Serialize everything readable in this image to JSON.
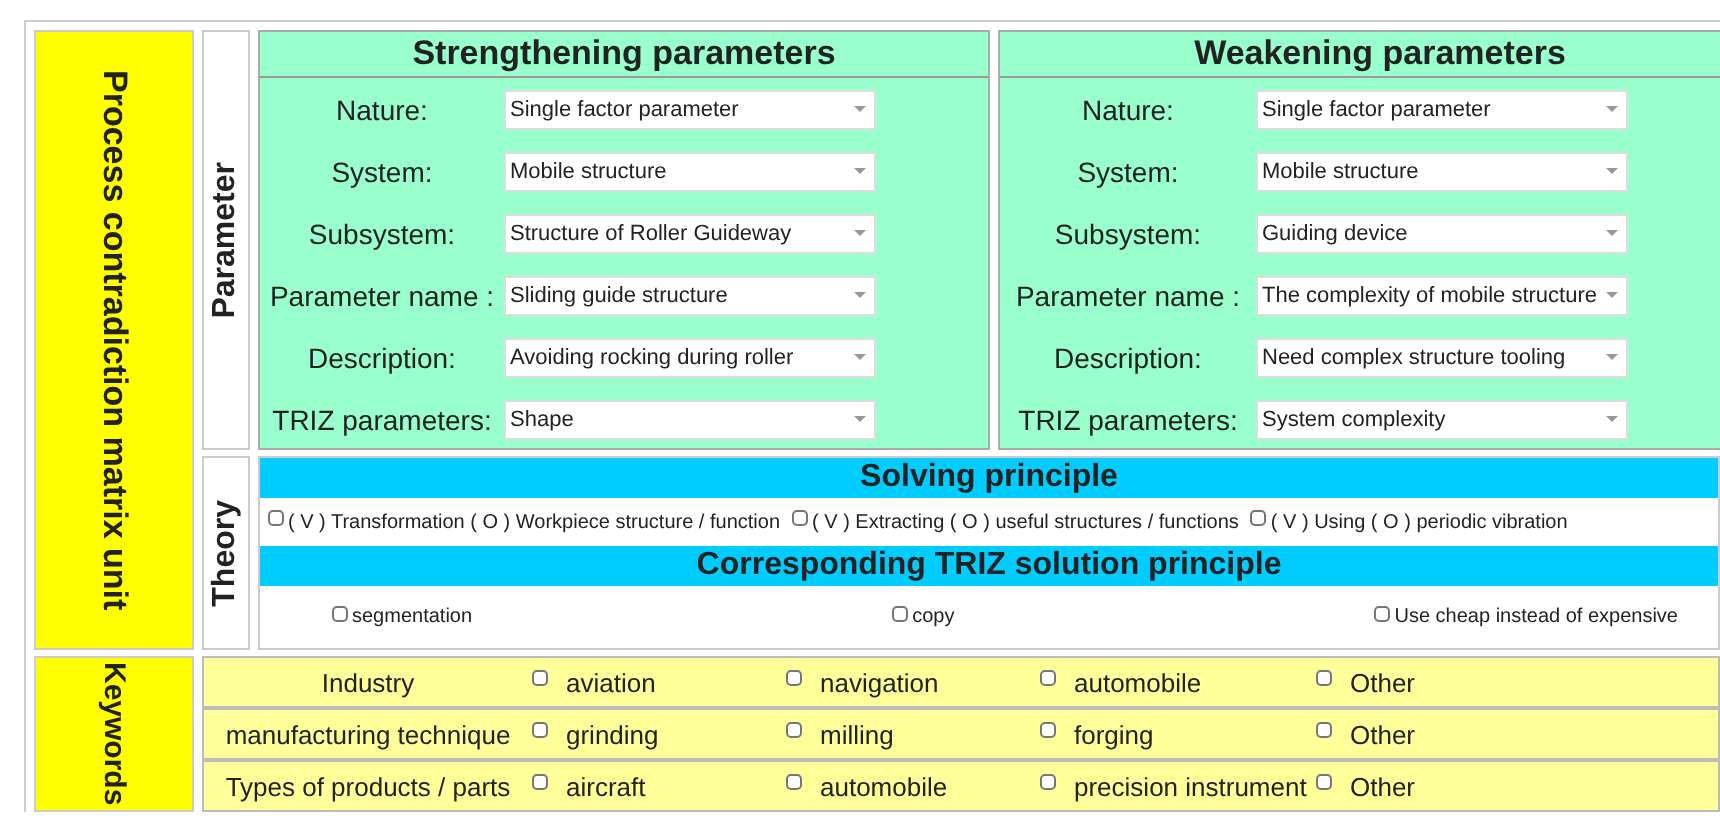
{
  "unit_title": "Process contradiction matrix unit",
  "parameter_section": {
    "label": "Parameter",
    "panels": [
      {
        "title": "Strengthening parameters",
        "fields": [
          {
            "label": "Nature:",
            "value": "Single factor parameter"
          },
          {
            "label": "System:",
            "value": "Mobile structure"
          },
          {
            "label": "Subsystem:",
            "value": "Structure of Roller Guideway"
          },
          {
            "label": "Parameter name :",
            "value": "Sliding guide structure"
          },
          {
            "label": "Description:",
            "value": "Avoiding rocking during roller"
          },
          {
            "label": "TRIZ parameters:",
            "value": "Shape"
          }
        ]
      },
      {
        "title": "Weakening parameters",
        "fields": [
          {
            "label": "Nature:",
            "value": "Single factor parameter"
          },
          {
            "label": "System:",
            "value": "Mobile structure"
          },
          {
            "label": "Subsystem:",
            "value": "Guiding device"
          },
          {
            "label": "Parameter name :",
            "value": "The complexity of mobile structure"
          },
          {
            "label": "Description:",
            "value": "Need complex structure tooling"
          },
          {
            "label": "TRIZ parameters:",
            "value": "System complexity"
          }
        ]
      }
    ]
  },
  "theory_section": {
    "label": "Theory",
    "solving_principle": {
      "title": "Solving principle",
      "options": [
        {
          "label": "( V ) Transformation ( O ) Workpiece structure / function",
          "checked": false
        },
        {
          "label": "( V ) Extracting ( O ) useful structures / functions",
          "checked": false
        },
        {
          "label": "( V ) Using ( O ) periodic vibration",
          "checked": false
        }
      ]
    },
    "triz_principle": {
      "title": "Corresponding TRIZ solution principle",
      "options": [
        {
          "label": "segmentation",
          "checked": false
        },
        {
          "label": "copy",
          "checked": false
        },
        {
          "label": "Use cheap instead of expensive",
          "checked": false
        }
      ]
    }
  },
  "keywords_section": {
    "label": "Keywords",
    "rows": [
      {
        "label": "Industry",
        "options": [
          {
            "label": "aviation",
            "checked": false
          },
          {
            "label": "navigation",
            "checked": false
          },
          {
            "label": "automobile",
            "checked": false
          },
          {
            "label": "Other",
            "checked": false
          }
        ]
      },
      {
        "label": "manufacturing technique",
        "options": [
          {
            "label": "grinding",
            "checked": false
          },
          {
            "label": "milling",
            "checked": false
          },
          {
            "label": "forging",
            "checked": false
          },
          {
            "label": "Other",
            "checked": false
          }
        ]
      },
      {
        "label": "Types of products / parts",
        "options": [
          {
            "label": "aircraft",
            "checked": false
          },
          {
            "label": "automobile",
            "checked": false
          },
          {
            "label": "precision instrument",
            "checked": false
          },
          {
            "label": "Other",
            "checked": false
          }
        ]
      }
    ]
  }
}
